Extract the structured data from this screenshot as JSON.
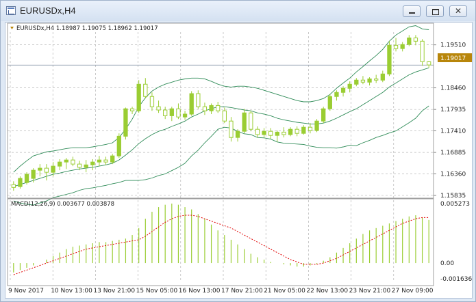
{
  "window": {
    "title": "EURUSDx,H4",
    "close_glyph": "✕"
  },
  "chart_header": {
    "symbol_info": "EURUSDx,H4  1.18987 1.19075 1.18962 1.19017"
  },
  "price_scale": [
    "1.19510",
    "1.18460",
    "1.17935",
    "1.17410",
    "1.16885",
    "1.16360",
    "1.15835"
  ],
  "current_price": "1.19017",
  "macd": {
    "header": "MACD(12,26,9) 0.003677 0.003878",
    "scale": [
      "0.005273",
      "0.00",
      "-0.001636"
    ]
  },
  "time_labels": [
    "9 Nov 2017",
    "10 Nov 13:00",
    "13 Nov 21:00",
    "15 Nov 05:00",
    "16 Nov 13:00",
    "17 Nov 21:00",
    "21 Nov 05:00",
    "22 Nov 13:00",
    "23 Nov 21:00",
    "27 Nov 09:00"
  ],
  "colors": {
    "bull": "#9acd32",
    "band": "#2e8b57",
    "signal": "#e00000",
    "grid": "#a8a8a8",
    "price_tag": "#b8860b"
  },
  "chart_data": {
    "type": "candlestick",
    "price_range": [
      1.15835,
      1.19822
    ],
    "candles": [
      [
        1.161,
        1.1618,
        1.1595,
        1.1603
      ],
      [
        1.1605,
        1.163,
        1.16,
        1.1625
      ],
      [
        1.1615,
        1.164,
        1.161,
        1.1635
      ],
      [
        1.1625,
        1.165,
        1.1615,
        1.1645
      ],
      [
        1.1645,
        1.166,
        1.163,
        1.165
      ],
      [
        1.165,
        1.166,
        1.162,
        1.164
      ],
      [
        1.164,
        1.1665,
        1.163,
        1.1655
      ],
      [
        1.1655,
        1.1672,
        1.1645,
        1.1665
      ],
      [
        1.1665,
        1.1675,
        1.1648,
        1.167
      ],
      [
        1.167,
        1.1678,
        1.1655,
        1.166
      ],
      [
        1.166,
        1.1668,
        1.1645,
        1.1652
      ],
      [
        1.1652,
        1.167,
        1.164,
        1.1658
      ],
      [
        1.1658,
        1.1672,
        1.1645,
        1.1665
      ],
      [
        1.1665,
        1.168,
        1.1655,
        1.167
      ],
      [
        1.167,
        1.1678,
        1.1658,
        1.1665
      ],
      [
        1.1665,
        1.1685,
        1.166,
        1.168
      ],
      [
        1.168,
        1.1735,
        1.1675,
        1.1728
      ],
      [
        1.1728,
        1.1798,
        1.172,
        1.1795
      ],
      [
        1.1795,
        1.18,
        1.1782,
        1.179
      ],
      [
        1.179,
        1.1865,
        1.1785,
        1.1855
      ],
      [
        1.1855,
        1.187,
        1.182,
        1.1825
      ],
      [
        1.1825,
        1.1835,
        1.179,
        1.18
      ],
      [
        1.18,
        1.1815,
        1.1785,
        1.1792
      ],
      [
        1.1792,
        1.18,
        1.177,
        1.1778
      ],
      [
        1.1778,
        1.18,
        1.1765,
        1.1795
      ],
      [
        1.1795,
        1.1808,
        1.177,
        1.1775
      ],
      [
        1.1775,
        1.179,
        1.1768,
        1.1782
      ],
      [
        1.1782,
        1.1838,
        1.1778,
        1.1832
      ],
      [
        1.1832,
        1.184,
        1.1795,
        1.18
      ],
      [
        1.18,
        1.181,
        1.178,
        1.179
      ],
      [
        1.179,
        1.1808,
        1.1782,
        1.1803
      ],
      [
        1.1803,
        1.1812,
        1.1785,
        1.179
      ],
      [
        1.179,
        1.1798,
        1.176,
        1.1765
      ],
      [
        1.1765,
        1.1775,
        1.1715,
        1.1725
      ],
      [
        1.1725,
        1.1745,
        1.1715,
        1.174
      ],
      [
        1.174,
        1.1795,
        1.1735,
        1.1785
      ],
      [
        1.1785,
        1.179,
        1.174,
        1.1745
      ],
      [
        1.1745,
        1.1752,
        1.1725,
        1.1732
      ],
      [
        1.1732,
        1.1748,
        1.1725,
        1.174
      ],
      [
        1.174,
        1.1748,
        1.1722,
        1.173
      ],
      [
        1.173,
        1.1742,
        1.1715,
        1.1738
      ],
      [
        1.1738,
        1.175,
        1.1725,
        1.1732
      ],
      [
        1.1732,
        1.175,
        1.1728,
        1.1745
      ],
      [
        1.1745,
        1.1752,
        1.1728,
        1.1735
      ],
      [
        1.1735,
        1.1755,
        1.1732,
        1.175
      ],
      [
        1.175,
        1.176,
        1.1735,
        1.1742
      ],
      [
        1.1742,
        1.177,
        1.1738,
        1.1765
      ],
      [
        1.1765,
        1.18,
        1.176,
        1.1795
      ],
      [
        1.1795,
        1.183,
        1.179,
        1.1825
      ],
      [
        1.1825,
        1.184,
        1.1815,
        1.1835
      ],
      [
        1.1835,
        1.185,
        1.1825,
        1.1845
      ],
      [
        1.1845,
        1.1862,
        1.1835,
        1.1855
      ],
      [
        1.1855,
        1.187,
        1.185,
        1.1865
      ],
      [
        1.1865,
        1.1875,
        1.1855,
        1.186
      ],
      [
        1.186,
        1.1872,
        1.1852,
        1.1868
      ],
      [
        1.1868,
        1.1878,
        1.1858,
        1.1865
      ],
      [
        1.1865,
        1.1888,
        1.186,
        1.188
      ],
      [
        1.188,
        1.196,
        1.1875,
        1.195
      ],
      [
        1.195,
        1.1968,
        1.1935,
        1.1942
      ],
      [
        1.1942,
        1.1958,
        1.1935,
        1.1952
      ],
      [
        1.1952,
        1.1975,
        1.1948,
        1.1968
      ],
      [
        1.1968,
        1.1975,
        1.195,
        1.196
      ],
      [
        1.196,
        1.1965,
        1.19,
        1.191
      ],
      [
        1.191,
        1.1912,
        1.1895,
        1.1902
      ]
    ],
    "band_upper": [
      1.164,
      1.1655,
      1.1668,
      1.168,
      1.1685,
      1.169,
      1.1692,
      1.1695,
      1.1698,
      1.17,
      1.17,
      1.17,
      1.1702,
      1.1705,
      1.1708,
      1.1712,
      1.1725,
      1.1745,
      1.177,
      1.18,
      1.1822,
      1.1838,
      1.1848,
      1.1855,
      1.186,
      1.1865,
      1.1868,
      1.187,
      1.187,
      1.1868,
      1.1862,
      1.1855,
      1.185,
      1.1848,
      1.185,
      1.185,
      1.1848,
      1.1845,
      1.184,
      1.1835,
      1.183,
      1.1825,
      1.182,
      1.1815,
      1.1812,
      1.1812,
      1.1815,
      1.182,
      1.183,
      1.1845,
      1.1858,
      1.187,
      1.1885,
      1.1898,
      1.1912,
      1.1925,
      1.194,
      1.196,
      1.1975,
      1.1985,
      1.1995,
      1.1998,
      1.199,
      1.1988
    ],
    "band_middle": [
      1.1605,
      1.161,
      1.1615,
      1.162,
      1.1625,
      1.163,
      1.1635,
      1.1638,
      1.1642,
      1.1645,
      1.1648,
      1.165,
      1.1652,
      1.1655,
      1.1658,
      1.1662,
      1.167,
      1.1682,
      1.1695,
      1.171,
      1.1722,
      1.1732,
      1.174,
      1.1745,
      1.1752,
      1.1758,
      1.1765,
      1.1775,
      1.1782,
      1.179,
      1.1795,
      1.18,
      1.18,
      1.1798,
      1.1795,
      1.1792,
      1.179,
      1.1785,
      1.1782,
      1.1778,
      1.1772,
      1.1768,
      1.1765,
      1.1762,
      1.176,
      1.1758,
      1.1758,
      1.176,
      1.1765,
      1.1772,
      1.178,
      1.1788,
      1.1795,
      1.1805,
      1.1815,
      1.1825,
      1.1835,
      1.1848,
      1.1858,
      1.1868,
      1.1878,
      1.1885,
      1.189,
      1.1895
    ],
    "band_lower": [
      1.157,
      1.1565,
      1.1562,
      1.156,
      1.1565,
      1.157,
      1.1578,
      1.1582,
      1.1586,
      1.159,
      1.1596,
      1.16,
      1.1602,
      1.1605,
      1.1608,
      1.1612,
      1.1615,
      1.162,
      1.162,
      1.162,
      1.1622,
      1.1626,
      1.1632,
      1.1636,
      1.1644,
      1.1652,
      1.1662,
      1.168,
      1.1694,
      1.1712,
      1.1728,
      1.1745,
      1.175,
      1.1748,
      1.174,
      1.1734,
      1.1732,
      1.1725,
      1.1724,
      1.1721,
      1.1714,
      1.1711,
      1.171,
      1.1709,
      1.1708,
      1.1704,
      1.1701,
      1.17,
      1.17,
      1.1699,
      1.1702,
      1.1706,
      1.1705,
      1.1712,
      1.1718,
      1.1725,
      1.173,
      1.1736,
      1.1741,
      1.1751,
      1.1761,
      1.1772,
      1.179,
      1.1802
    ],
    "macd_range": [
      -0.001636,
      0.005273
    ],
    "macd_hist": [
      -0.0008,
      -0.0006,
      -0.0004,
      -0.0002,
      0.0,
      0.0003,
      0.0006,
      0.0009,
      0.0012,
      0.0014,
      0.0015,
      0.0016,
      0.0017,
      0.0018,
      0.0018,
      0.0019,
      0.002,
      0.0021,
      0.0024,
      0.003,
      0.0038,
      0.0044,
      0.0048,
      0.005,
      0.0051,
      0.005,
      0.0048,
      0.0046,
      0.0042,
      0.0038,
      0.0033,
      0.0028,
      0.0024,
      0.002,
      0.0016,
      0.0012,
      0.0008,
      0.0005,
      0.0003,
      0.0001,
      0.0,
      -0.0001,
      -0.0002,
      -0.0003,
      -0.0003,
      -0.0002,
      -0.0001,
      0.0002,
      0.0005,
      0.0009,
      0.0013,
      0.0017,
      0.0021,
      0.0025,
      0.0028,
      0.003,
      0.0032,
      0.0034,
      0.0036,
      0.0038,
      0.004,
      0.0041,
      0.0039,
      0.0037
    ],
    "macd_signal": [
      -0.001,
      -0.0008,
      -0.0006,
      -0.0004,
      -0.0002,
      0.0,
      0.0002,
      0.0004,
      0.0006,
      0.0008,
      0.001,
      0.0012,
      0.0013,
      0.0014,
      0.0015,
      0.0016,
      0.0017,
      0.0018,
      0.0019,
      0.002,
      0.0023,
      0.0027,
      0.0031,
      0.0035,
      0.0038,
      0.004,
      0.0041,
      0.0041,
      0.004,
      0.0038,
      0.0036,
      0.0034,
      0.0032,
      0.003,
      0.0027,
      0.0024,
      0.0021,
      0.0018,
      0.0015,
      0.0012,
      0.0009,
      0.0006,
      0.0003,
      0.0001,
      -0.0001,
      -0.0001,
      -0.0001,
      0.0,
      0.0002,
      0.0004,
      0.0007,
      0.001,
      0.0013,
      0.0016,
      0.0019,
      0.0022,
      0.0025,
      0.0028,
      0.0031,
      0.0034,
      0.0036,
      0.0038,
      0.0039,
      0.0039
    ]
  }
}
